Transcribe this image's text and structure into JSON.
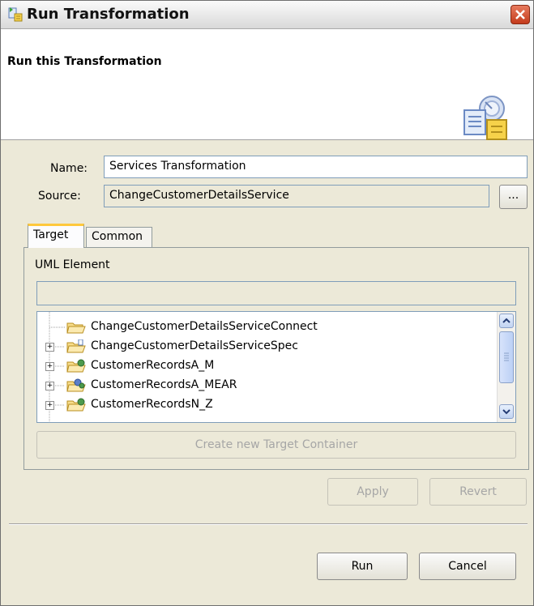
{
  "window": {
    "title": "Run Transformation",
    "close_icon": "close-icon"
  },
  "banner": {
    "title": "Run this Transformation",
    "icon": "transformation-wizard-icon"
  },
  "form": {
    "name_label": "Name:",
    "name_value": "Services Transformation",
    "source_label": "Source:",
    "source_value": "ChangeCustomerDetailsService",
    "browse_label": "..."
  },
  "tabs": [
    {
      "label": "Target",
      "selected": true
    },
    {
      "label": "Common",
      "selected": false
    }
  ],
  "target": {
    "uml_element_label": "UML Element",
    "uml_element_value": "",
    "tree": [
      {
        "label": "ChangeCustomerDetailsServiceConnect",
        "expandable": false,
        "icon": "folder-open-icon"
      },
      {
        "label": "ChangeCustomerDetailsServiceSpec",
        "expandable": true,
        "icon": "folder-open-icon"
      },
      {
        "label": "CustomerRecordsA_M",
        "expandable": true,
        "icon": "project-folder-icon"
      },
      {
        "label": "CustomerRecordsA_MEAR",
        "expandable": true,
        "icon": "ear-project-icon"
      },
      {
        "label": "CustomerRecordsN_Z",
        "expandable": true,
        "icon": "project-folder-icon"
      }
    ],
    "create_container_label": "Create new Target Container"
  },
  "actions": {
    "apply_label": "Apply",
    "revert_label": "Revert",
    "run_label": "Run",
    "cancel_label": "Cancel"
  },
  "colors": {
    "dialog_bg": "#ece9d8",
    "banner_bg": "#ffffff",
    "close_red": "#c43b1c",
    "field_border": "#7f9db9",
    "disabled_text": "#a6a6a6"
  }
}
